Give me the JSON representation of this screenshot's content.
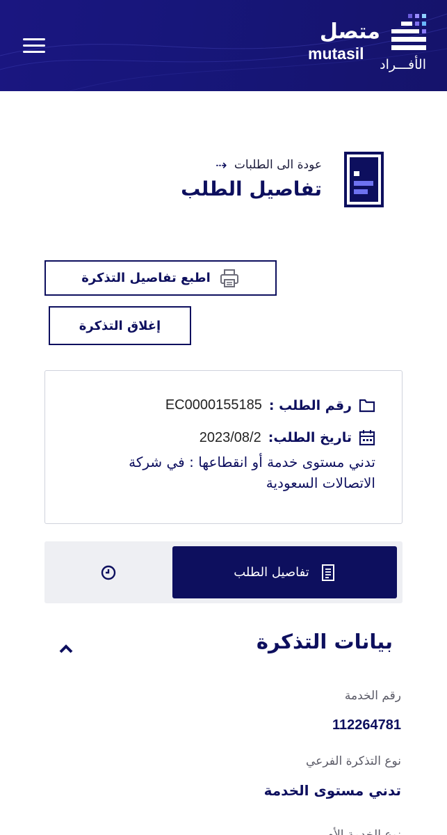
{
  "header": {
    "logo_ar": "متصل",
    "logo_en": "mutasil",
    "logo_sub": "الأفـــراد",
    "menu_icon": "hamburger-icon",
    "colors": {
      "bg": "#17167a",
      "accent": "#7a7cf0"
    }
  },
  "page": {
    "back_label": "عودة الى الطلبات",
    "title": "تفاصيل الطلب"
  },
  "actions": {
    "print_label": "اطبع تفاصيل التذكرة",
    "close_label": "إغلاق التذكرة"
  },
  "request": {
    "number_label": "رقم الطلب :",
    "number_value": "EC0000155185",
    "date_label": "تاريخ الطلب:",
    "date_value": "2023/08/2",
    "description": "تدني مستوى خدمة أو انقطاعها : في شركة الاتصالات السعودية"
  },
  "tabs": {
    "details_label": "تفاصيل الطلب",
    "history_icon": "clock-icon"
  },
  "ticket": {
    "section_title": "بيانات التذكرة",
    "service_number_label": "رقم الخدمة",
    "service_number_value": "112264781",
    "subtype_label": "نوع التذكرة الفرعي",
    "subtype_value": "تدني مستوى الخدمة",
    "next_label": "نوع الخدمة الأم"
  }
}
